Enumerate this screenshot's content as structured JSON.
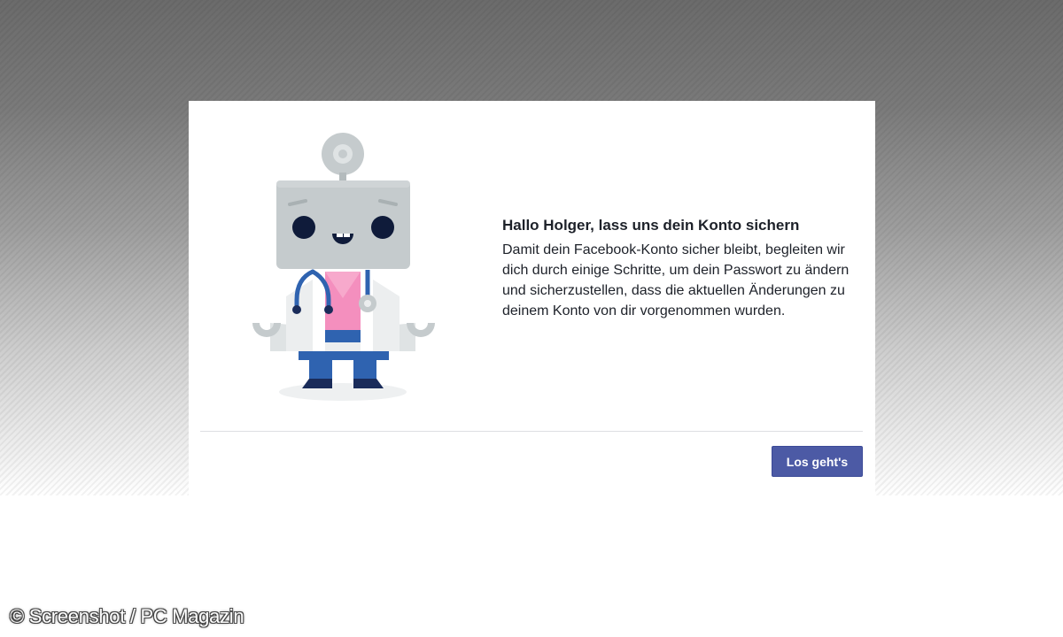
{
  "dialog": {
    "title": "Hallo Holger, lass uns dein Konto sichern",
    "body": "Damit dein Facebook-Konto sicher bleibt, begleiten wir dich durch einige Schritte, um dein Passwort zu ändern und sicherzustellen, dass die aktuellen Änderungen zu deinem Konto von dir vorgenommen wurden.",
    "button_label": "Los geht's"
  },
  "illustration": {
    "name": "doctor-robot-icon"
  },
  "watermark": {
    "text": "© Screenshot / PC Magazin"
  },
  "colors": {
    "button": "#4c5aa5",
    "robot_gray": "#c5cbcd",
    "robot_blue": "#2f63b0",
    "robot_pink": "#f48fbe"
  }
}
